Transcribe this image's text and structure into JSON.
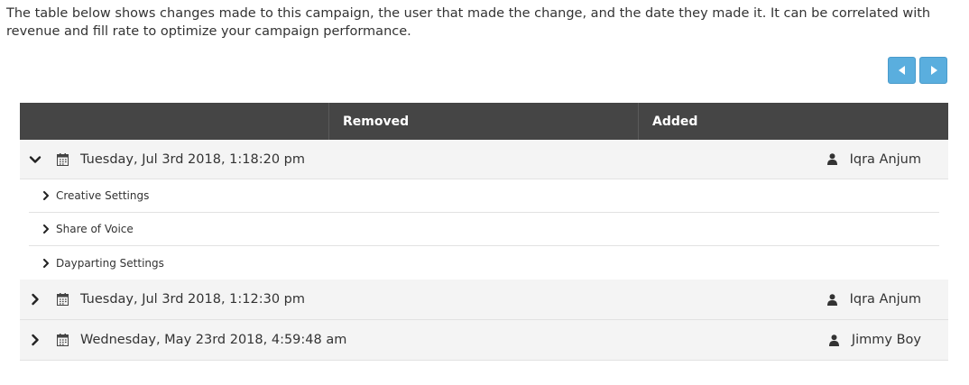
{
  "intro": {
    "text": "The table below shows changes made to this campaign, the user that made the change, and the date they made it. It can be correlated with revenue and fill rate to optimize your campaign performance."
  },
  "pager": {
    "prev_icon": "arrow-left-icon",
    "next_icon": "arrow-right-icon",
    "color": "#5aaede"
  },
  "table": {
    "columns": {
      "removed": "Removed",
      "added": "Added"
    },
    "header_color": "#454545",
    "groups": [
      {
        "date": "Tuesday, Jul 3rd 2018, 1:18:20 pm",
        "user": "Iqra Anjum",
        "expanded": true,
        "items": [
          "Creative Settings",
          "Share of Voice",
          "Dayparting Settings"
        ]
      },
      {
        "date": "Tuesday, Jul 3rd 2018, 1:12:30 pm",
        "user": "Iqra Anjum",
        "expanded": false
      },
      {
        "date": "Wednesday, May 23rd 2018, 4:59:48 am",
        "user": "Jimmy Boy",
        "expanded": false
      }
    ]
  }
}
